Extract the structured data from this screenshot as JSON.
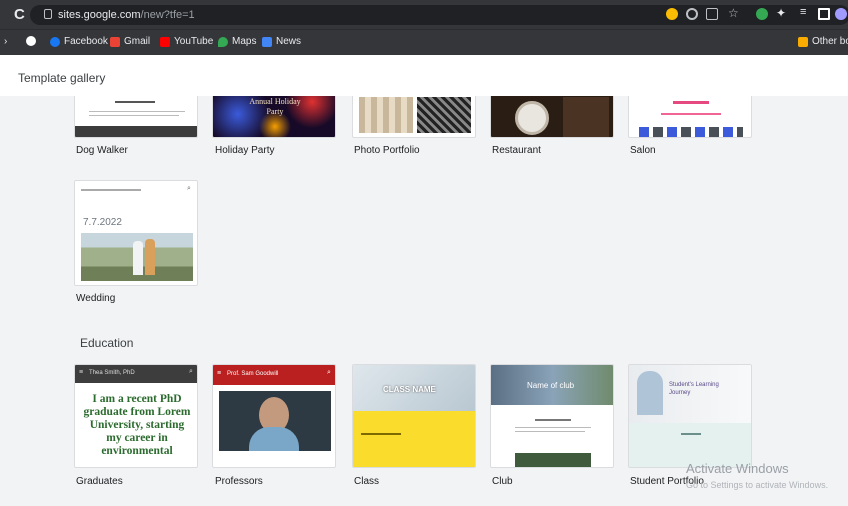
{
  "browser": {
    "url_host": "sites.google.com",
    "url_path": "/new?tfe=1",
    "bookmarks": [
      {
        "label": "Facebook",
        "color": "#1877f2"
      },
      {
        "label": "Gmail",
        "color": "#ea4335"
      },
      {
        "label": "YouTube",
        "color": "#ff0000"
      },
      {
        "label": "Maps",
        "color": "#34a853"
      },
      {
        "label": "News",
        "color": "#4285f4"
      }
    ],
    "other_bookmarks": "Other bo"
  },
  "app": {
    "title": "Template gallery",
    "sections": [
      {
        "title": "",
        "templates": [
          {
            "name": "Dog Walker"
          },
          {
            "name": "Holiday Party",
            "thumb_title": "Annual Holiday Party"
          },
          {
            "name": "Photo Portfolio"
          },
          {
            "name": "Restaurant"
          },
          {
            "name": "Salon"
          },
          {
            "name": "Wedding",
            "thumb_date": "7.7.2022"
          }
        ]
      },
      {
        "title": "Education",
        "templates": [
          {
            "name": "Graduates",
            "thumb_header": "Thea Smith, PhD",
            "thumb_text": "I am a recent PhD graduate from Lorem University, starting my career in environmental"
          },
          {
            "name": "Professors",
            "thumb_header": "Prof. Sam Goodwill"
          },
          {
            "name": "Class",
            "thumb_title": "CLASS NAME"
          },
          {
            "name": "Club",
            "thumb_title": "Name of club"
          },
          {
            "name": "Student Portfolio",
            "thumb_title": "Student's Learning Journey"
          }
        ]
      }
    ]
  },
  "watermark": {
    "line1": "Activate Windows",
    "line2": "Go to Settings to activate Windows."
  }
}
